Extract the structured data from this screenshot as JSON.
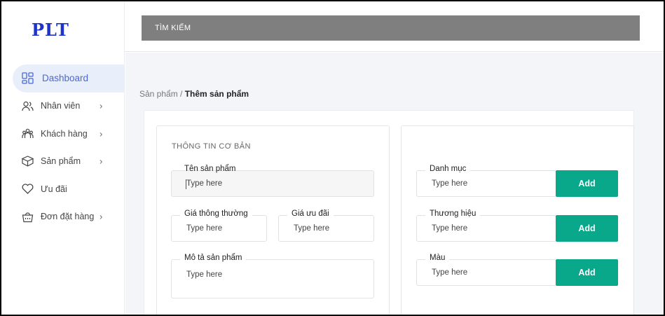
{
  "app": {
    "logo": "PLT"
  },
  "search": {
    "label": "TÌM KIẾM"
  },
  "sidebar": {
    "items": [
      {
        "label": "Dashboard",
        "icon": "dashboard-icon",
        "active": true,
        "chevron": false
      },
      {
        "label": "Nhân viên",
        "icon": "users-icon",
        "active": false,
        "chevron": true
      },
      {
        "label": "Khách hàng",
        "icon": "customers-icon",
        "active": false,
        "chevron": true
      },
      {
        "label": "Sản phẩm",
        "icon": "box-icon",
        "active": false,
        "chevron": true
      },
      {
        "label": "Ưu đãi",
        "icon": "heart-icon",
        "active": false,
        "chevron": false
      },
      {
        "label": "Đơn đặt hàng",
        "icon": "basket-icon",
        "active": false,
        "chevron": true
      }
    ]
  },
  "breadcrumb": {
    "parent": "Sản phẩm /",
    "current": "Thêm sản phẩm"
  },
  "basic_info": {
    "title": "THÔNG TIN CƠ BẢN",
    "name": {
      "label": "Tên sản phẩm",
      "placeholder": "Type here"
    },
    "regular_price": {
      "label": "Giá thông thường",
      "placeholder": "Type here"
    },
    "sale_price": {
      "label": "Giá ưu đãi",
      "placeholder": "Type here"
    },
    "description": {
      "label": "Mô tả sản phẩm",
      "placeholder": "Type here"
    }
  },
  "attributes": {
    "category": {
      "label": "Danh mục",
      "placeholder": "Type here",
      "button": "Add"
    },
    "brand": {
      "label": "Thương hiệu",
      "placeholder": "Type here",
      "button": "Add"
    },
    "color": {
      "label": "Màu",
      "placeholder": "Type here",
      "button": "Add"
    }
  },
  "colors": {
    "accent": "#0aa88a",
    "brand": "#1d33c9",
    "active_nav": "#4a68d8",
    "search_bg": "#7f7f7f"
  }
}
